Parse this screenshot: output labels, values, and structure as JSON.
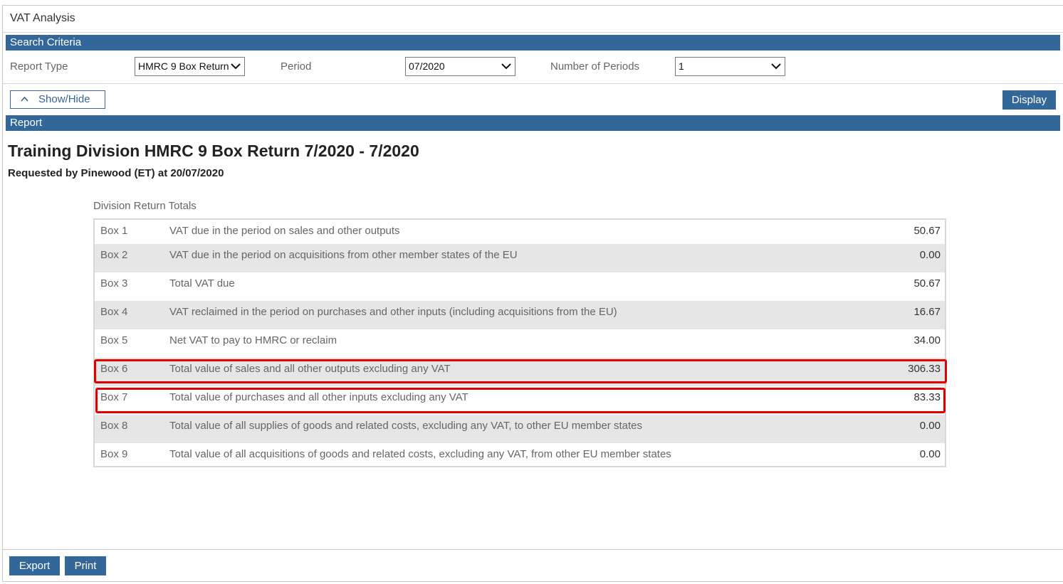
{
  "window": {
    "title": "VAT Analysis"
  },
  "search_criteria": {
    "header": "Search Criteria",
    "report_type": {
      "label": "Report Type",
      "value": "HMRC 9 Box Return"
    },
    "period": {
      "label": "Period",
      "value": "07/2020"
    },
    "num_periods": {
      "label": "Number of Periods",
      "value": "1"
    }
  },
  "toolbar": {
    "show_hide": "Show/Hide",
    "display": "Display"
  },
  "report": {
    "header": "Report",
    "title": "Training Division HMRC 9 Box Return 7/2020 - 7/2020",
    "subtitle": "Requested by Pinewood (ET) at 20/07/2020",
    "group_label": "Division Return Totals",
    "rows": [
      {
        "box": "Box 1",
        "desc": "VAT due in the period on sales and other outputs",
        "value": "50.67"
      },
      {
        "box": "Box 2",
        "desc": "VAT due in the period on acquisitions from other member states of the EU",
        "value": "0.00"
      },
      {
        "box": "Box 3",
        "desc": "Total VAT due",
        "value": "50.67"
      },
      {
        "box": "Box 4",
        "desc": "VAT reclaimed in the period on purchases and other inputs (including acquisitions from the EU)",
        "value": "16.67"
      },
      {
        "box": "Box 5",
        "desc": "Net VAT to pay to HMRC or reclaim",
        "value": "34.00"
      },
      {
        "box": "Box 6",
        "desc": "Total value of sales and all other outputs excluding any VAT",
        "value": "306.33"
      },
      {
        "box": "Box 7",
        "desc": "Total value of purchases and all other inputs excluding any VAT",
        "value": "83.33"
      },
      {
        "box": "Box 8",
        "desc": "Total value of all supplies of goods and related costs, excluding any VAT, to other EU member states",
        "value": "0.00"
      },
      {
        "box": "Box 9",
        "desc": "Total value of all acquisitions of goods and related costs, excluding any VAT, from other EU member states",
        "value": "0.00"
      }
    ]
  },
  "footer": {
    "export": "Export",
    "print": "Print"
  },
  "colors": {
    "header_blue": "#336699",
    "highlight_red": "#e00000",
    "row_shade": "#e6e6e6"
  },
  "icons": {
    "dropdown": "chevron-down-icon",
    "show_hide": "chevron-up-icon"
  }
}
